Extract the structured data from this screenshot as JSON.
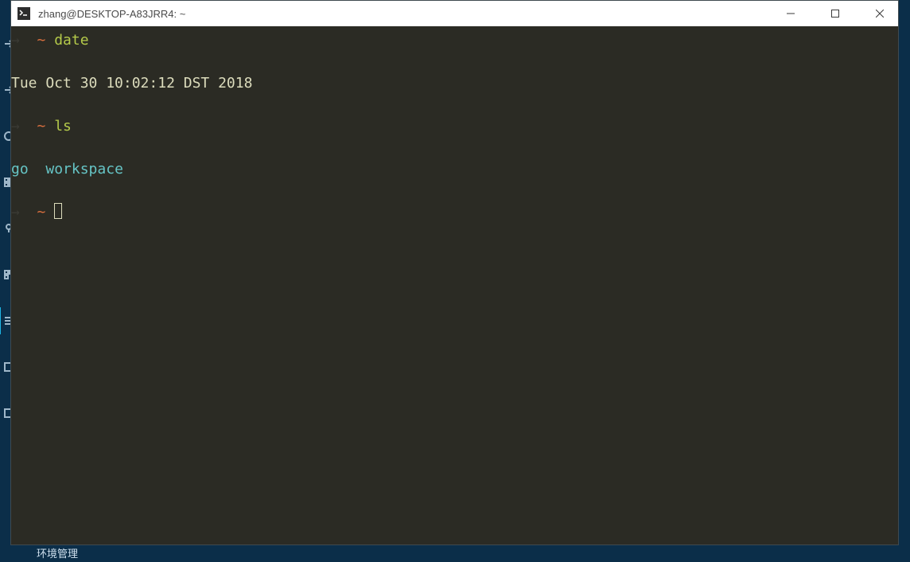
{
  "sidebar": {
    "items": [
      {
        "icon": "arrow-icon"
      },
      {
        "icon": "arrow-icon"
      },
      {
        "icon": "globe-icon"
      },
      {
        "icon": "grid-icon"
      },
      {
        "icon": "marker-icon"
      },
      {
        "icon": "apps-icon"
      },
      {
        "icon": "list-icon",
        "active": true
      },
      {
        "icon": "layers-icon"
      },
      {
        "icon": "edit-icon"
      }
    ]
  },
  "bottom_bar": {
    "label": "环境管理"
  },
  "window": {
    "title": "zhang@DESKTOP-A83JRR4: ~"
  },
  "terminal": {
    "lines": [
      {
        "type": "prompt",
        "path": "~",
        "command": "date"
      },
      {
        "type": "output",
        "text": "Tue Oct 30 10:02:12 DST 2018"
      },
      {
        "type": "prompt",
        "path": "~",
        "command": "ls"
      },
      {
        "type": "output_dirs",
        "items": [
          "go",
          "workspace"
        ]
      },
      {
        "type": "prompt_cursor",
        "path": "~"
      }
    ]
  },
  "colors": {
    "term_bg": "#2b2b24",
    "prompt_tilde": "#d96f3e",
    "cmd_green": "#b5ca4a",
    "dir_cyan": "#66c5c6",
    "sidebar_bg": "#0b2e49"
  }
}
